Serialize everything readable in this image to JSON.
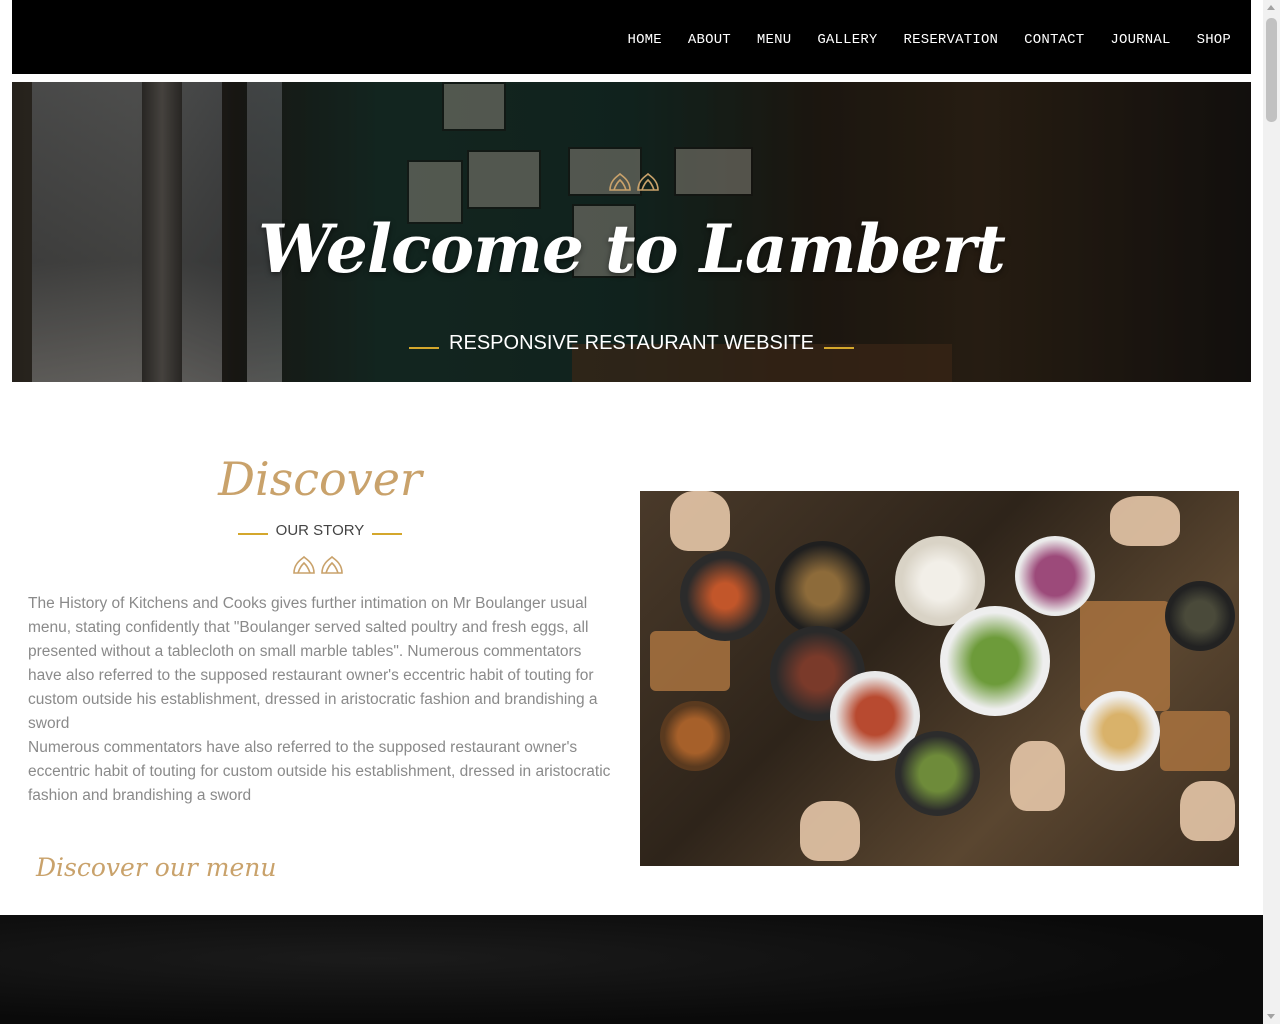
{
  "nav": {
    "items": [
      "HOME",
      "ABOUT",
      "MENU",
      "GALLERY",
      "RESERVATION",
      "CONTACT",
      "JOURNAL",
      "SHOP"
    ]
  },
  "hero": {
    "title": "Welcome to Lambert",
    "subtitle": "RESPONSIVE RESTAURANT WEBSITE",
    "ornament_icon": "lotus-ornament-icon"
  },
  "discover": {
    "title": "Discover",
    "label": "OUR STORY",
    "ornament_icon": "lotus-ornament-icon",
    "paragraph_1": "The History of Kitchens and Cooks gives further intimation on Mr Boulanger usual menu, stating confidently that \"Boulanger served salted poultry and fresh eggs, all presented without a tablecloth on small marble tables\". Numerous commentators have also referred to the supposed restaurant owner's eccentric habit of touting for custom outside his establishment, dressed in aristocratic fashion and brandishing a sword",
    "paragraph_2": "Numerous commentators have also referred to the supposed restaurant owner's eccentric habit of touting for custom outside his establishment, dressed in aristocratic fashion and brandishing a sword",
    "menu_link": "Discover our menu"
  },
  "colors": {
    "accent_gold": "#c9a26b",
    "line_gold": "#d4a72c",
    "nav_bg": "#000000",
    "text_gray": "#8a8a8a"
  }
}
